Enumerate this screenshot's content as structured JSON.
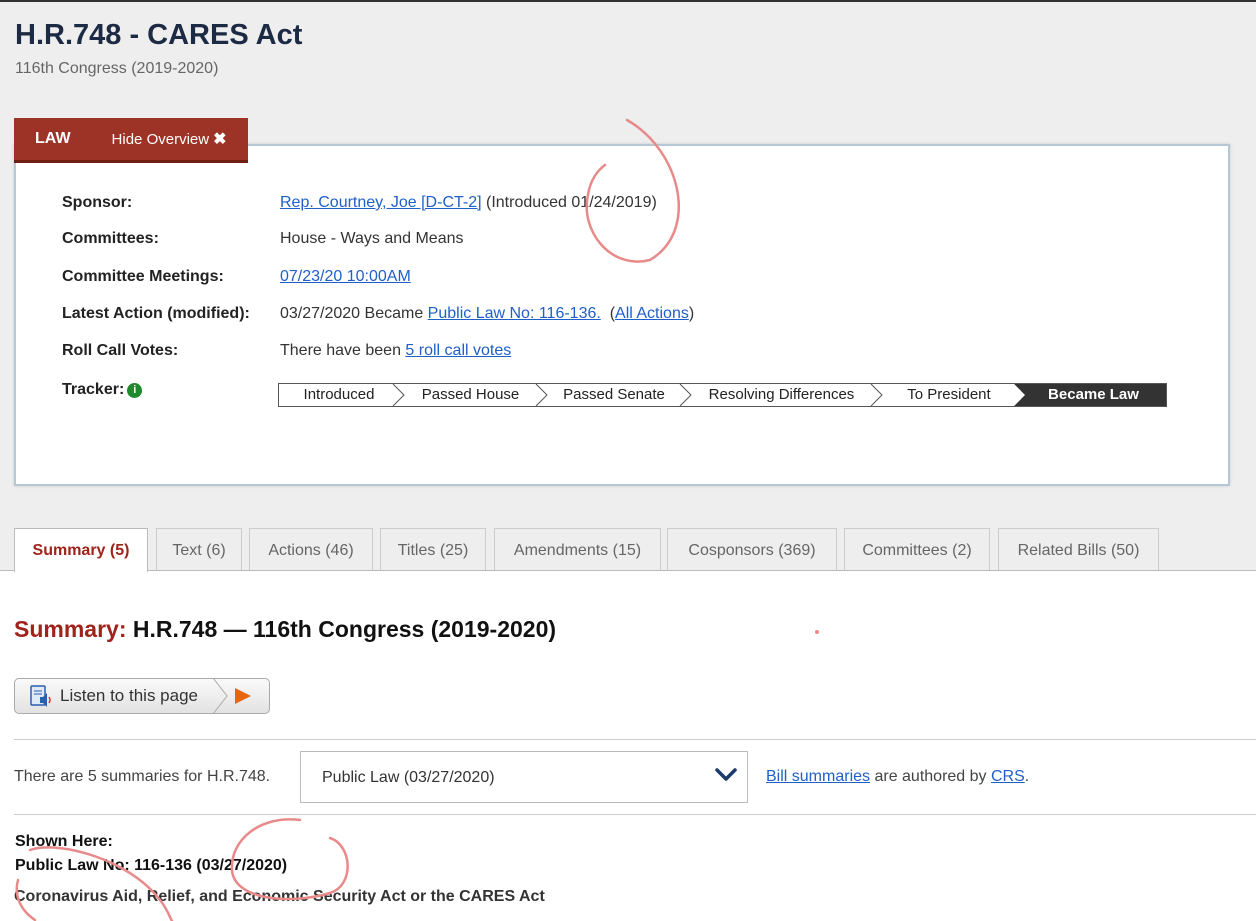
{
  "header": {
    "title": "H.R.748 - CARES Act",
    "congress": "116th Congress (2019-2020)"
  },
  "overview": {
    "status_label": "LAW",
    "hide_label": "Hide Overview",
    "sponsor_label": "Sponsor:",
    "sponsor_name": "Rep. Courtney, Joe [D-CT-2]",
    "sponsor_intro": " (Introduced 01/24/2019)",
    "committees_label": "Committees:",
    "committees_value": "House - Ways and Means",
    "meetings_label": "Committee Meetings:",
    "meetings_value": "07/23/20 10:00AM",
    "latest_label": "Latest Action (modified):",
    "latest_prefix": "03/27/2020 Became ",
    "latest_link": "Public Law No: 116-136.",
    "latest_all_open": "  (",
    "latest_all_link": "All Actions",
    "latest_all_close": ")",
    "rollcall_label": "Roll Call Votes:",
    "rollcall_prefix": "There have been ",
    "rollcall_link": "5 roll call votes",
    "tracker_label": "Tracker:",
    "tracker_steps": [
      "Introduced",
      "Passed House",
      "Passed Senate",
      "Resolving Differences",
      "To President",
      "Became Law"
    ]
  },
  "tabs": [
    {
      "label": "Summary (5)"
    },
    {
      "label": "Text (6)"
    },
    {
      "label": "Actions (46)"
    },
    {
      "label": "Titles (25)"
    },
    {
      "label": "Amendments (15)"
    },
    {
      "label": "Cosponsors (369)"
    },
    {
      "label": "Committees (2)"
    },
    {
      "label": "Related Bills (50)"
    }
  ],
  "summary": {
    "heading_red": "Summary:",
    "heading_rest": " H.R.748 — 116th Congress (2019-2020)",
    "listen_label": "Listen to this page",
    "count_text": "There are 5 summaries for H.R.748.",
    "select_value": "Public Law (03/27/2020)",
    "authored_link": "Bill summaries",
    "authored_mid": " are authored by ",
    "authored_crs": "CRS",
    "authored_end": ".",
    "shown_here": "Shown Here:",
    "public_law": "Public Law No: 116-136 (03/27/2020)",
    "act_title": "Coronavirus Aid, Relief, and Economic Security Act or the CARES Act"
  },
  "icons": {
    "close": "close-icon",
    "info": "info-icon",
    "speaker": "speaker-icon",
    "play": "play-icon",
    "chevron": "chevron-down-icon"
  },
  "colors": {
    "law_bar": "#9c3326",
    "tab_active_text": "#a0231b",
    "link": "#1f5fc8",
    "tracker_active": "#333333",
    "info_icon": "#1e8a2e",
    "play_icon": "#e8650f",
    "annotation_ink": "#e88a8a"
  }
}
